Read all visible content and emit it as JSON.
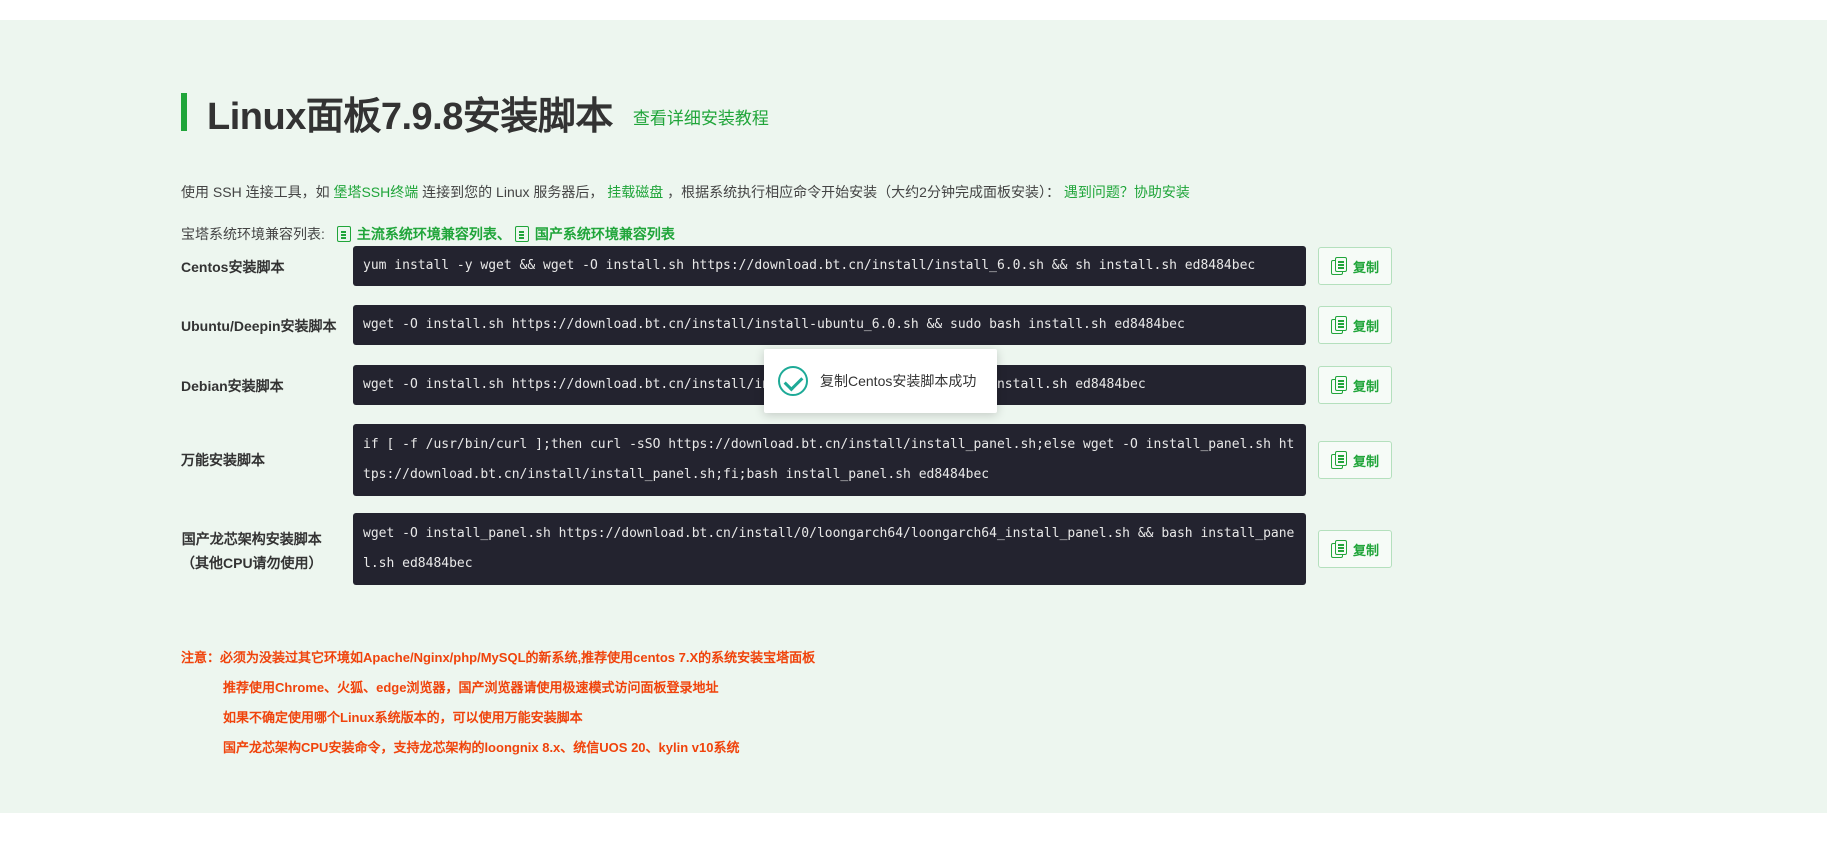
{
  "heading": {
    "title": "Linux面板7.9.8安装脚本",
    "tutorial_link": "查看详细安装教程"
  },
  "intro": {
    "part1": "使用 SSH 连接工具，如 ",
    "link_ssh": "堡塔SSH终端",
    "part2": " 连接到您的 Linux 服务器后， ",
    "link_disk": "挂载磁盘",
    "part3": " ，根据系统执行相应命令开始安装（大约2分钟完成面板安装）： ",
    "link_help": "遇到问题？协助安装"
  },
  "compat": {
    "label": "宝塔系统环境兼容列表:",
    "link_main": "主流系统环境兼容列表",
    "sep": "、",
    "link_domestic": "国产系统环境兼容列表"
  },
  "copy_label": "复制",
  "scripts": [
    {
      "label": "Centos安装脚本",
      "label2": "",
      "command": "yum install -y wget && wget -O install.sh https://download.bt.cn/install/install_6.0.sh && sh install.sh ed8484bec"
    },
    {
      "label": "Ubuntu/Deepin安装脚本",
      "label2": "",
      "command": "wget -O install.sh https://download.bt.cn/install/install-ubuntu_6.0.sh && sudo bash install.sh ed8484bec"
    },
    {
      "label": "Debian安装脚本",
      "label2": "",
      "command": "wget -O install.sh https://download.bt.cn/install/install-ubuntu_6.0.sh && bash install.sh ed8484bec"
    },
    {
      "label": "万能安装脚本",
      "label2": "",
      "command": "if [ -f /usr/bin/curl ];then curl -sSO https://download.bt.cn/install/install_panel.sh;else wget -O install_panel.sh https://download.bt.cn/install/install_panel.sh;fi;bash install_panel.sh ed8484bec"
    },
    {
      "label": "国产龙芯架构安装脚本",
      "label2": "（其他CPU请勿使用）",
      "command": "wget -O install_panel.sh https://download.bt.cn/install/0/loongarch64/loongarch64_install_panel.sh && bash install_panel.sh ed8484bec"
    }
  ],
  "notes": [
    "注意：必须为没装过其它环境如Apache/Nginx/php/MySQL的新系统,推荐使用centos 7.X的系统安装宝塔面板",
    "推荐使用Chrome、火狐、edge浏览器，国产浏览器请使用极速模式访问面板登录地址",
    "如果不确定使用哪个Linux系统版本的，可以使用万能安装脚本",
    "国产龙芯架构CPU安装命令，支持龙芯架构的loongnix 8.x、统信UOS 20、kylin v10系统"
  ],
  "toast": {
    "message": "复制Centos安装脚本成功"
  },
  "colors": {
    "accent": "#20a53a",
    "warning": "#f0430b",
    "terminal_bg": "#23232f",
    "section_bg": "#edf6ef"
  }
}
